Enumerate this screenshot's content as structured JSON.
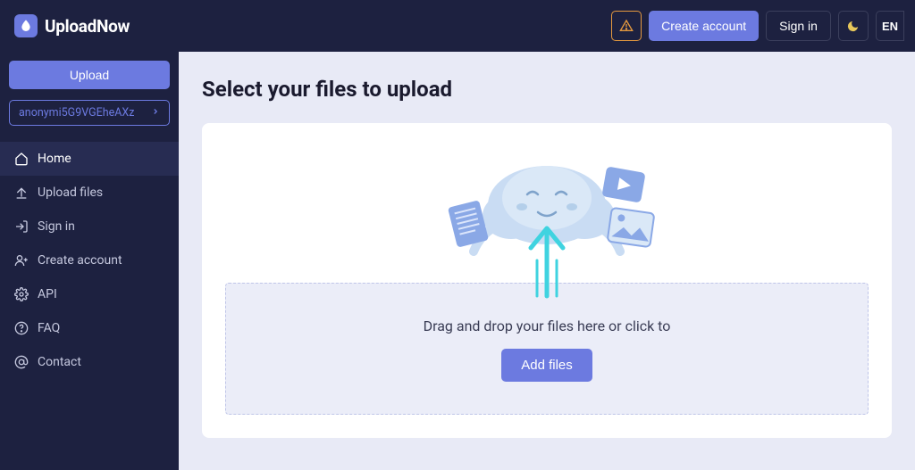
{
  "logo": {
    "text": "UploadNow"
  },
  "header": {
    "create_account": "Create account",
    "sign_in": "Sign in",
    "language": "EN"
  },
  "sidebar": {
    "upload_label": "Upload",
    "anon_id": "anonymi5G9VGEheAXz",
    "items": [
      {
        "label": "Home"
      },
      {
        "label": "Upload files"
      },
      {
        "label": "Sign in"
      },
      {
        "label": "Create account"
      },
      {
        "label": "API"
      },
      {
        "label": "FAQ"
      },
      {
        "label": "Contact"
      }
    ]
  },
  "page": {
    "title": "Select your files to upload"
  },
  "dropzone": {
    "text": "Drag and drop your files here or click to",
    "button": "Add files"
  }
}
